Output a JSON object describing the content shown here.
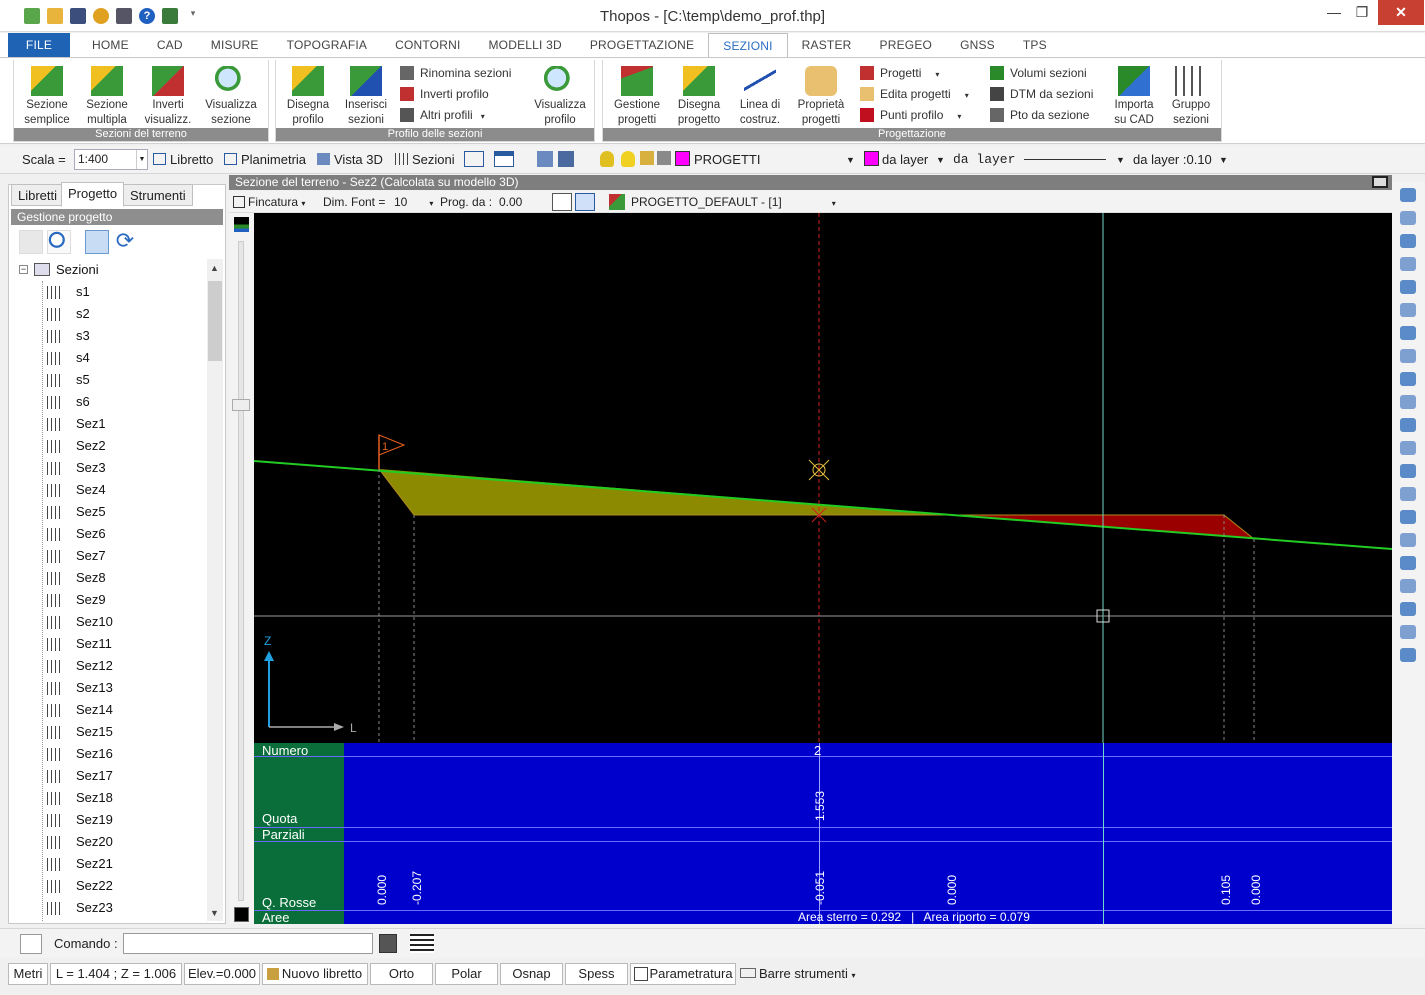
{
  "app": {
    "title": "Thopos - [C:\\temp\\demo_prof.thp]"
  },
  "window_controls": {
    "minimize": "—",
    "maximize": "❐",
    "close": "✕"
  },
  "ribbon_tabs": [
    "FILE",
    "HOME",
    "CAD",
    "MISURE",
    "TOPOGRAFIA",
    "CONTORNI",
    "MODELLI 3D",
    "PROGETTAZIONE",
    "SEZIONI",
    "RASTER",
    "PREGEO",
    "GNSS",
    "TPS"
  ],
  "active_tab": "SEZIONI",
  "ribbon": {
    "groups": [
      {
        "label": "Sezioni del terreno",
        "buttons": [
          [
            "Sezione",
            "semplice"
          ],
          [
            "Sezione",
            "multipla"
          ],
          [
            "Inverti",
            "visualizz."
          ],
          [
            "Visualizza",
            "sezione"
          ]
        ]
      },
      {
        "label": "Profilo delle sezioni",
        "buttons": [
          [
            "Disegna",
            "profilo"
          ],
          [
            "Inserisci",
            "sezioni"
          ],
          [
            "Visualizza",
            "profilo"
          ]
        ],
        "small": [
          "Rinomina sezioni",
          "Inverti profilo",
          "Altri profili"
        ]
      },
      {
        "label": "Progettazione",
        "buttons": [
          [
            "Gestione",
            "progetti"
          ],
          [
            "Disegna",
            "progetto"
          ],
          [
            "Linea di",
            "costruz."
          ],
          [
            "Proprietà",
            "progetti"
          ],
          [
            "Importa",
            "su CAD"
          ],
          [
            "Gruppo",
            "sezioni"
          ]
        ],
        "small": [
          "Progetti",
          "Edita progetti",
          "Punti profilo",
          "Volumi sezioni",
          "DTM da sezioni",
          "Pto da sezione"
        ]
      }
    ]
  },
  "toolbar": {
    "scala_label": "Scala =",
    "scala_value": "1:400",
    "libretto": "Libretto",
    "planimetria": "Planimetria",
    "vista3d": "Vista 3D",
    "sezioni": "Sezioni",
    "layer": "PROGETTI",
    "color_mode": "da layer",
    "linetype": "da layer",
    "lineweight": "da layer :0.10",
    "layer_color": "#ff00ff"
  },
  "left_panel": {
    "tabs": [
      "Libretti",
      "Progetto",
      "Strumenti"
    ],
    "active_tab": "Progetto",
    "header": "Gestione progetto",
    "tree_root": "Sezioni",
    "items": [
      "s1",
      "s2",
      "s3",
      "s4",
      "s5",
      "s6",
      "Sez1",
      "Sez2",
      "Sez3",
      "Sez4",
      "Sez5",
      "Sez6",
      "Sez7",
      "Sez8",
      "Sez9",
      "Sez10",
      "Sez11",
      "Sez12",
      "Sez13",
      "Sez14",
      "Sez15",
      "Sez16",
      "Sez17",
      "Sez18",
      "Sez19",
      "Sez20",
      "Sez21",
      "Sez22",
      "Sez23"
    ]
  },
  "view": {
    "title": "Sezione del terreno - Sez2 (Calcolata su modello 3D)",
    "fincatura": "Fincatura",
    "dim_font_label": "Dim. Font =",
    "dim_font_value": "10",
    "prog_label": "Prog. da :",
    "prog_value": "0.00",
    "project": "PROGETTO_DEFAULT - [1]",
    "flag_label": "1",
    "axis_z": "Z",
    "axis_l": "L"
  },
  "grid": {
    "row_numero": "Numero",
    "row_quota": "Quota",
    "row_parziali": "Parziali",
    "row_qrosse": "Q. Rosse",
    "row_aree": "Aree",
    "numero_value": "2",
    "quota_value": "1.553",
    "qrosse_values": [
      "0.000",
      "-0.207",
      "-0.051",
      "0.000",
      "0.105",
      "0.000"
    ],
    "aree_text": "Area sterro = 0.292   |   Area riporto = 0.079",
    "colors": {
      "grid_bg": "#0000cc",
      "label_bg": "#0a6e3a",
      "sterro": "#8b8a00",
      "riporto": "#9b0000",
      "terrain": "#22cc22"
    }
  },
  "command": {
    "label": "Comando :",
    "value": ""
  },
  "status": {
    "unit": "Metri",
    "coords": "L = 1.404 ; Z = 1.006",
    "elev": "Elev.=0.000",
    "nuovo_libretto": "Nuovo libretto",
    "orto": "Orto",
    "polar": "Polar",
    "osnap": "Osnap",
    "spess": "Spess",
    "parametratura": "Parametratura",
    "barre": "Barre strumenti"
  }
}
